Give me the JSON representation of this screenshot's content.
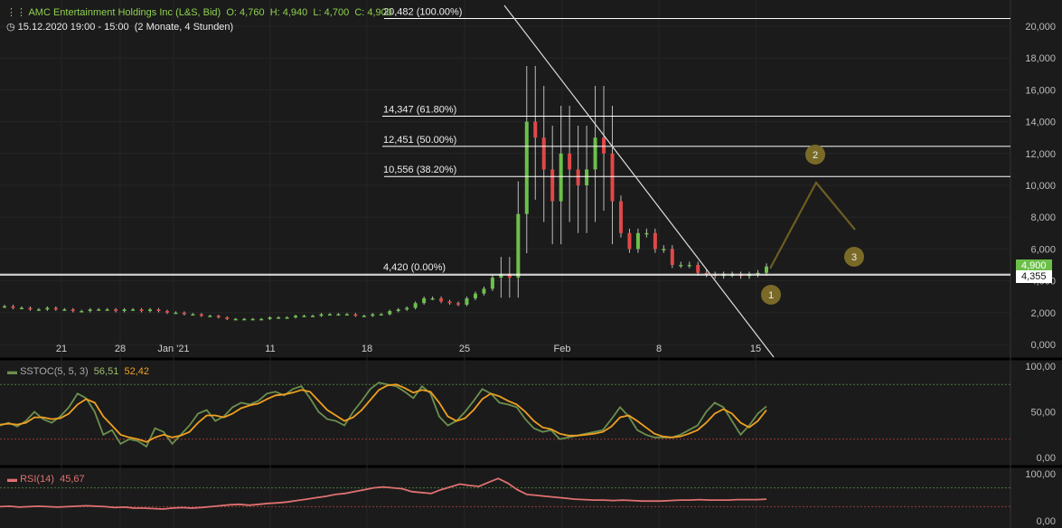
{
  "header": {
    "instrument": "AMC Entertainment Holdings Inc (L&S, Bid)",
    "open_label": "O:",
    "open": "4,760",
    "high_label": "H:",
    "high": "4,940",
    "low_label": "L:",
    "low": "4,700",
    "close_label": "C:",
    "close": "4,900",
    "period": "15.12.2020 19:00 - 15:00",
    "interval": "(2 Monate, 4 Stunden)"
  },
  "colors": {
    "background": "#1b1b1b",
    "up": "#6cc04a",
    "down": "#e04848",
    "stoch_k": "#6b8f4e",
    "stoch_d": "#f0a020",
    "rsi": "#e07070",
    "fib": "#ffffff",
    "forecast": "#6b5d22",
    "marker": "#7a6a28"
  },
  "chart_data": [
    {
      "type": "candlestick",
      "title": "",
      "ylim": [
        0,
        21000
      ],
      "y_ticks": [
        "0,000",
        "2,000",
        "4,000",
        "6,000",
        "8,000",
        "10,000",
        "12,000",
        "14,000",
        "16,000",
        "18,000",
        "20,000"
      ],
      "x_ticks": [
        "21",
        "28",
        "Jan '21",
        "11",
        "18",
        "25",
        "Feb",
        "8",
        "15"
      ],
      "last_price_up": "4,900",
      "last_price_marker": "4,355",
      "fibonacci": [
        {
          "label": "20,482 (100.00%)",
          "value": 20.482
        },
        {
          "label": "14,347 (61.80%)",
          "value": 14.347
        },
        {
          "label": "12,451 (50.00%)",
          "value": 12.451
        },
        {
          "label": "10,556 (38.20%)",
          "value": 10.556
        },
        {
          "label": "4,420 (0.00%)",
          "value": 4.42
        }
      ],
      "wave_labels": [
        "1",
        "2",
        "3"
      ],
      "close_series": [
        2.4,
        2.3,
        2.3,
        2.2,
        2.2,
        2.3,
        2.2,
        2.2,
        2.1,
        2.1,
        2.2,
        2.2,
        2.2,
        2.1,
        2.2,
        2.2,
        2.1,
        2.2,
        2.1,
        2.0,
        2.0,
        1.9,
        1.9,
        1.8,
        1.8,
        1.7,
        1.6,
        1.6,
        1.6,
        1.6,
        1.6,
        1.7,
        1.7,
        1.7,
        1.8,
        1.8,
        1.8,
        1.9,
        1.9,
        1.9,
        1.9,
        1.8,
        1.8,
        1.9,
        1.9,
        2.1,
        2.2,
        2.3,
        2.6,
        2.9,
        2.9,
        2.7,
        2.6,
        2.5,
        2.9,
        3.2,
        3.5,
        4.2,
        4.4,
        4.2,
        8.2,
        14,
        13,
        11,
        9,
        12,
        11,
        10,
        11,
        13,
        12,
        9,
        7,
        6,
        7,
        7,
        6,
        6,
        5,
        5,
        5,
        4.5,
        4.4,
        4.3,
        4.4,
        4.4,
        4.3,
        4.4,
        4.5,
        4.9
      ]
    },
    {
      "type": "line",
      "name": "SSTOC(5, 5, 3)",
      "values_label": [
        "56,51",
        "52,42"
      ],
      "ylim": [
        0,
        100
      ],
      "y_ticks": [
        "0,00",
        "50,00",
        "100,00"
      ],
      "levels": [
        20,
        80
      ],
      "series": [
        {
          "name": "%K",
          "values": [
            35,
            38,
            34,
            40,
            50,
            42,
            38,
            45,
            55,
            70,
            65,
            50,
            25,
            30,
            15,
            20,
            18,
            12,
            32,
            28,
            15,
            25,
            35,
            48,
            52,
            40,
            45,
            55,
            60,
            58,
            62,
            70,
            72,
            68,
            75,
            78,
            65,
            50,
            42,
            40,
            35,
            50,
            62,
            75,
            82,
            80,
            78,
            72,
            65,
            78,
            70,
            45,
            35,
            40,
            50,
            62,
            75,
            70,
            60,
            58,
            55,
            42,
            32,
            28,
            30,
            20,
            22,
            24,
            26,
            28,
            30,
            42,
            55,
            45,
            30,
            25,
            22,
            22,
            22,
            25,
            30,
            35,
            50,
            60,
            55,
            40,
            25,
            35,
            48,
            56
          ]
        },
        {
          "name": "%D",
          "values": [
            36,
            37,
            36,
            38,
            44,
            44,
            42,
            43,
            48,
            58,
            64,
            60,
            45,
            35,
            25,
            22,
            20,
            17,
            22,
            25,
            22,
            24,
            28,
            38,
            46,
            46,
            44,
            48,
            54,
            57,
            59,
            64,
            68,
            69,
            71,
            74,
            72,
            62,
            52,
            46,
            40,
            44,
            52,
            63,
            74,
            79,
            80,
            76,
            71,
            74,
            72,
            60,
            45,
            40,
            43,
            52,
            64,
            70,
            67,
            62,
            58,
            50,
            40,
            33,
            31,
            26,
            24,
            24,
            25,
            26,
            28,
            34,
            44,
            46,
            40,
            33,
            26,
            23,
            22,
            23,
            26,
            30,
            38,
            48,
            53,
            48,
            38,
            33,
            40,
            52
          ]
        }
      ]
    },
    {
      "type": "line",
      "name": "RSI(14)",
      "values_label": [
        "45,67"
      ],
      "ylim": [
        0,
        100
      ],
      "y_ticks": [
        "0,00",
        "100,00"
      ],
      "levels": [
        30,
        70
      ],
      "series": [
        {
          "name": "RSI",
          "values": [
            30,
            31,
            29,
            30,
            31,
            30,
            29,
            30,
            31,
            32,
            31,
            30,
            28,
            29,
            27,
            27,
            26,
            25,
            27,
            28,
            27,
            28,
            30,
            32,
            34,
            35,
            33,
            35,
            37,
            38,
            40,
            43,
            46,
            49,
            52,
            56,
            58,
            62,
            66,
            70,
            72,
            70,
            68,
            62,
            60,
            58,
            66,
            72,
            78,
            75,
            73,
            82,
            90,
            80,
            66,
            56,
            54,
            52,
            50,
            48,
            46,
            45,
            44,
            44,
            43,
            44,
            43,
            42,
            42,
            42,
            43,
            44,
            44,
            45,
            44,
            44,
            44,
            45,
            45,
            45,
            46
          ]
        }
      ]
    }
  ]
}
